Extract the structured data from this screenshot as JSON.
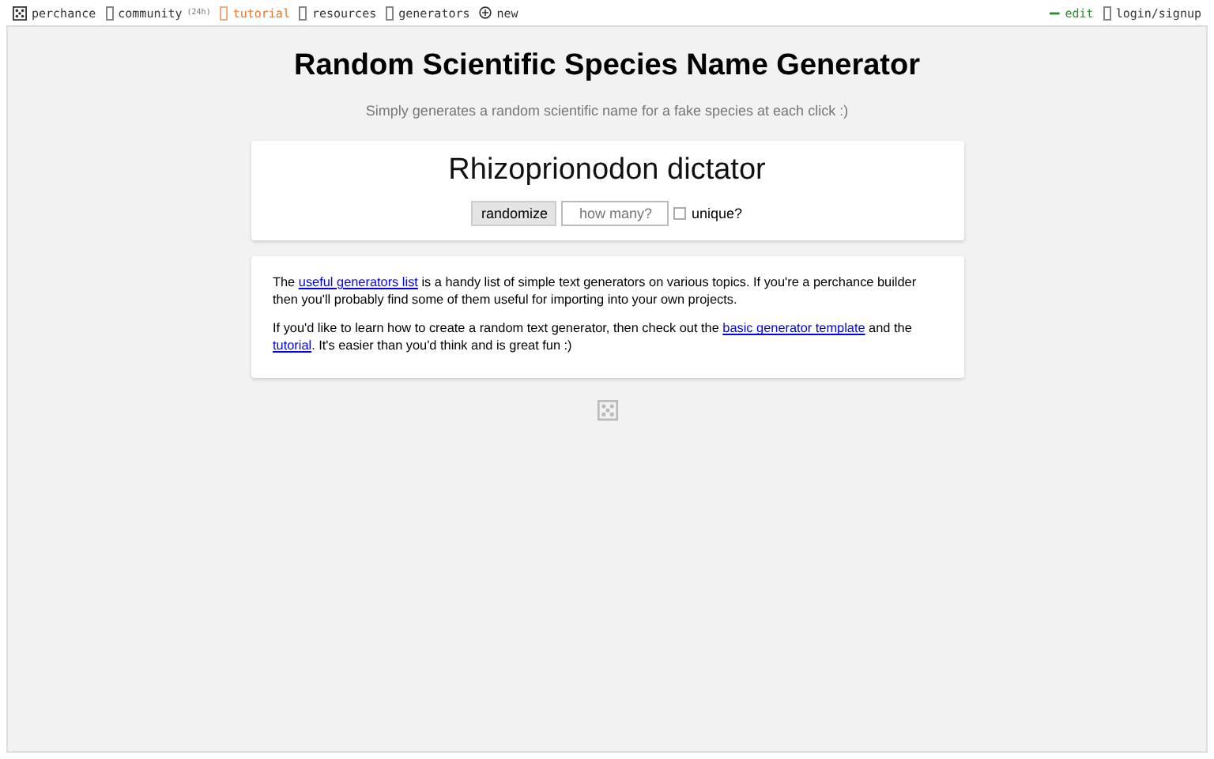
{
  "nav": {
    "brand": "perchance",
    "items": [
      {
        "label": "community",
        "badge": "(24h)",
        "selected": false
      },
      {
        "label": "tutorial",
        "selected": true
      },
      {
        "label": "resources",
        "selected": false
      },
      {
        "label": "generators",
        "selected": false
      },
      {
        "label": "new",
        "kind": "new",
        "selected": false
      }
    ],
    "right": [
      {
        "label": "edit",
        "kind": "edit"
      },
      {
        "label": "login/signup",
        "kind": "login"
      }
    ]
  },
  "title": "Random Scientific Species Name Generator",
  "subtitle": "Simply generates a random scientific name for a fake species at each click :)",
  "result": "Rhizoprionodon dictator",
  "controls": {
    "button": "randomize",
    "count_placeholder": "how many?",
    "unique_label": "unique?",
    "unique_checked": false
  },
  "info": [
    [
      {
        "text": "The "
      },
      {
        "text": "useful generators list",
        "link": true
      },
      {
        "text": " is a handy list of simple text generators on various topics. If you're a perchance builder then you'll probably find some of them useful for importing into your own projects."
      }
    ],
    [
      {
        "text": "If you'd like to learn how to create a random text generator, then check out the "
      },
      {
        "text": "basic generator template",
        "link": true
      },
      {
        "text": " and the "
      },
      {
        "text": "tutorial",
        "link": true
      },
      {
        "text": ". It's easier than you'd think and is great fun :)"
      }
    ]
  ]
}
